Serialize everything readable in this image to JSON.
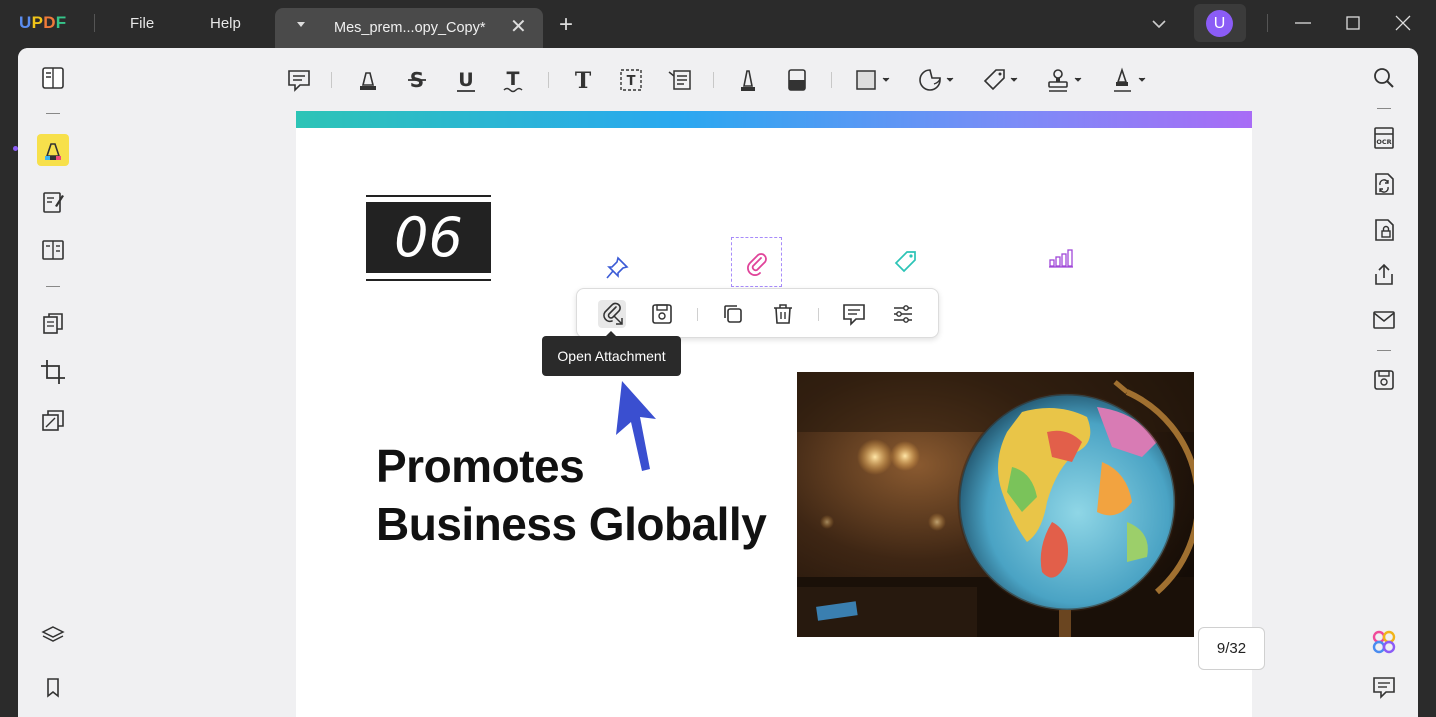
{
  "app": {
    "logo_letters": [
      "U",
      "P",
      "D",
      "F"
    ],
    "logo_colors": [
      "#5b8def",
      "#f0c419",
      "#f07a3a",
      "#36c58a"
    ]
  },
  "menu": {
    "file": "File",
    "help": "Help"
  },
  "tab": {
    "title": "Mes_prem...opy_Copy*",
    "close": "✕"
  },
  "new_tab": "+",
  "user": {
    "avatar_letter": "U",
    "avatar_color": "#8b5cf6"
  },
  "document": {
    "number": "06",
    "headline_line1": "Promotes",
    "headline_line2": "Business Globally"
  },
  "popup": {
    "tooltip": "Open Attachment"
  },
  "pagination": {
    "label": "9/32",
    "current": 9,
    "total": 32
  },
  "colors": {
    "highlight_active": "#f7e04b",
    "pin": "#3b5bd6",
    "paperclip": "#e0449a",
    "tag": "#2cc4b6",
    "chart": "#a048d8",
    "cursor": "#3a4fd0"
  }
}
